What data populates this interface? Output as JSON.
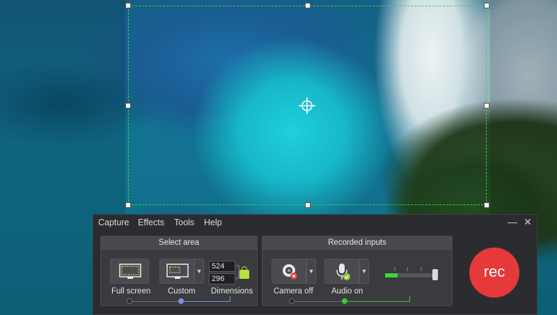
{
  "menu": {
    "items": [
      "Capture",
      "Effects",
      "Tools",
      "Help"
    ],
    "minimize_glyph": "—",
    "close_glyph": "✕"
  },
  "select_area": {
    "title": "Select area",
    "full_screen_label": "Full screen",
    "custom_label": "Custom",
    "dimensions_label": "Dimensions",
    "width_value": "524",
    "height_value": "296",
    "aspect_locked": true
  },
  "recorded_inputs": {
    "title": "Recorded inputs",
    "camera_label": "Camera off",
    "camera_enabled": false,
    "audio_label": "Audio on",
    "audio_enabled": true,
    "audio_level": 0.25
  },
  "rec_button": {
    "label": "rec"
  },
  "icons": {
    "full_screen": "monitor-fullscreen-icon",
    "custom": "monitor-custom-icon",
    "lock": "lock-icon",
    "camera": "webcam-icon",
    "microphone": "microphone-icon",
    "crosshair": "move-crosshair-icon",
    "dropdown": "chevron-down-icon"
  },
  "colors": {
    "selection_border": "#37d63f",
    "rec": "#e5393a",
    "lock": "#b8e23c",
    "audio_level": "#3fd63a",
    "slider_active_area": "#7a8fe0",
    "slider_active_inputs": "#46c43b",
    "panel_bg": "#2b2c2f"
  }
}
